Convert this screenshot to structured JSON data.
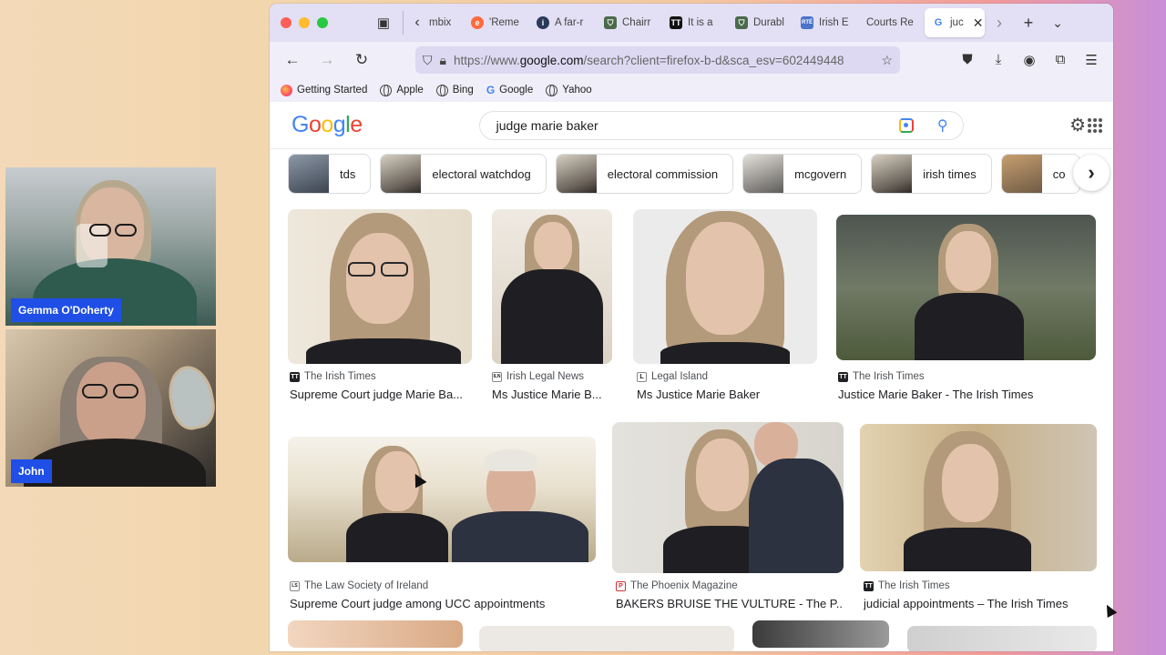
{
  "call": {
    "participants": [
      {
        "name": "Gemma O'Doherty"
      },
      {
        "name": "John"
      }
    ]
  },
  "browser": {
    "tabs": [
      {
        "label": "mbix",
        "fav": "",
        "fav_color": "#888888"
      },
      {
        "label": "'Reme",
        "fav": "e",
        "fav_color": "#ff6a3d"
      },
      {
        "label": "A far-r",
        "fav": "i",
        "fav_color": "#2a3a5a"
      },
      {
        "label": "Chairr",
        "fav": "⛉",
        "fav_color": "#4a6a4a"
      },
      {
        "label": "It is a",
        "fav": "TT",
        "fav_color": "#111111"
      },
      {
        "label": "Durabl",
        "fav": "⛉",
        "fav_color": "#4a6a4a"
      },
      {
        "label": "Irish E",
        "fav": "RTÉ",
        "fav_color": "#4a73c9"
      },
      {
        "label": "Courts Re",
        "fav": "",
        "fav_color": "#e3dff4"
      }
    ],
    "active_tab": {
      "label": "juc",
      "fav": "G"
    },
    "url_prefix": "https://www.",
    "url_domain": "google.com",
    "url_rest": "/search?client=firefox-b-d&sca_esv=602449448",
    "bookmarks": [
      {
        "label": "Getting Started",
        "icon": "firefox-icon"
      },
      {
        "label": "Apple",
        "icon": "globe-icon"
      },
      {
        "label": "Bing",
        "icon": "globe-icon"
      },
      {
        "label": "Google",
        "icon": "google-icon"
      },
      {
        "label": "Yahoo",
        "icon": "globe-icon"
      }
    ]
  },
  "google": {
    "logo": "Google",
    "query": "judge marie baker",
    "chips": [
      "tds",
      "electoral watchdog",
      "electoral commission",
      "mcgovern",
      "irish times",
      "co"
    ],
    "results": [
      {
        "source": "The Irish Times",
        "title": "Supreme Court judge Marie Ba...",
        "fav": "TT"
      },
      {
        "source": "Irish Legal News",
        "title": "Ms Justice Marie B...",
        "fav": "ILN"
      },
      {
        "source": "Legal Island",
        "title": "Ms Justice Marie Baker",
        "fav": "L"
      },
      {
        "source": "The Irish Times",
        "title": "Justice Marie Baker - The Irish Times",
        "fav": "TT"
      },
      {
        "source": "The Law Society of Ireland",
        "title": "Supreme Court judge among UCC appointments",
        "fav": "LS"
      },
      {
        "source": "The Phoenix Magazine",
        "title": "BAKERS BRUISE THE VULTURE - The P...",
        "fav": "P"
      },
      {
        "source": "The Irish Times",
        "title": "judicial appointments – The Irish Times",
        "fav": "TT"
      }
    ]
  }
}
